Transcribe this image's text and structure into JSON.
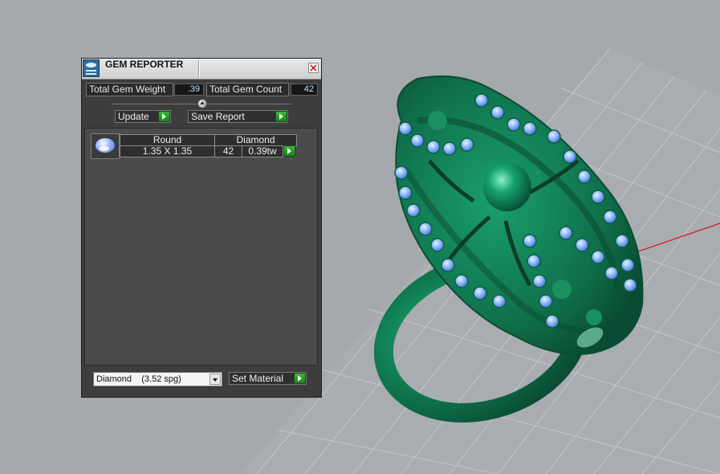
{
  "panel": {
    "title": "GEM REPORTER",
    "total_weight_label": "Total Gem Weight",
    "total_weight_value": ".39",
    "total_count_label": "Total Gem Count",
    "total_count_value": "42",
    "update_label": "Update",
    "save_report_label": "Save Report",
    "gem_rows": [
      {
        "shape": "Round",
        "material": "Diamond",
        "size": "1.35 X 1.35",
        "count": "42",
        "weight": "0.39tw"
      }
    ],
    "material_select_value": "Diamond    (3.52 spg)",
    "set_material_label": "Set Material"
  },
  "colors": {
    "background": "#a5a8ac",
    "grid": "#c6c8cc",
    "ring_green": "#11845a",
    "gem_blue": "#7aa9f4",
    "go_button": "#2e9c2e"
  },
  "icons": [
    "gem-reporter-icon",
    "close-icon",
    "slider-knob-icon",
    "arrow-right-icon",
    "round-diamond-icon",
    "chevron-down-icon"
  ]
}
